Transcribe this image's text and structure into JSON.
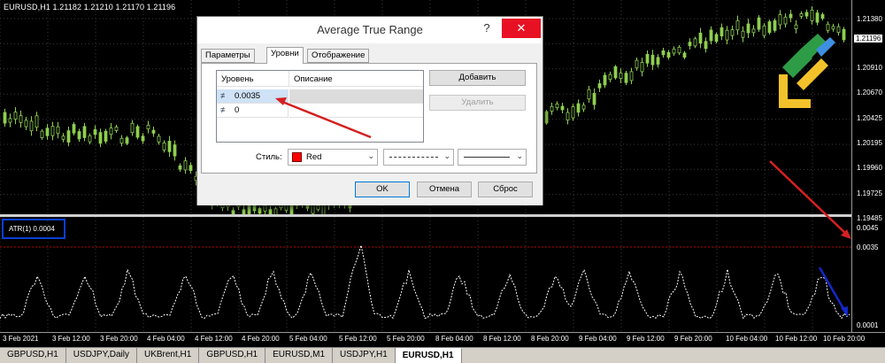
{
  "chart": {
    "header": "EURUSD,H1  1.21182 1.21210 1.21170 1.21196",
    "price_labels": [
      "1.21380",
      "1.20910",
      "1.20670",
      "1.20425",
      "1.20195",
      "1.19960",
      "1.19725",
      "1.19485"
    ],
    "current_price": "1.21196",
    "indicator_price_labels": [
      "0.0045",
      "0.0035",
      "0.0001"
    ],
    "time_labels": [
      "3 Feb 2021",
      "3 Feb 12:00",
      "3 Feb 20:00",
      "4 Feb 04:00",
      "4 Feb 12:00",
      "4 Feb 20:00",
      "5 Feb 04:00",
      "5 Feb 12:00",
      "5 Feb 20:00",
      "8 Feb 04:00",
      "8 Feb 12:00",
      "8 Feb 20:00",
      "9 Feb 04:00",
      "9 Feb 12:00",
      "9 Feb 20:00",
      "10 Feb 04:00",
      "10 Feb 12:00",
      "10 Feb 20:00"
    ],
    "atr_label": "ATR(1) 0.0004",
    "colors": {
      "up_candle": "#8fcf4f",
      "grid": "#3a3a3a",
      "level_line": "#c00000",
      "highlight_box": "#0a3fd8",
      "arrow": "#d42020"
    }
  },
  "tabs": [
    "GBPUSD,H1",
    "USDJPY,Daily",
    "UKBrent,H1",
    "GBPUSD,H1",
    "EURUSD,M1",
    "USDJPY,H1",
    "EURUSD,H1"
  ],
  "active_tab_index": 6,
  "dialog": {
    "title": "Average True Range",
    "help": "?",
    "close": "✕",
    "tabs": [
      "Параметры",
      "Уровни",
      "Отображение"
    ],
    "active_tab": "Уровни",
    "table": {
      "col_level": "Уровень",
      "col_desc": "Описание",
      "rows": [
        {
          "value": "0.0035",
          "description": "",
          "selected": true
        },
        {
          "value": "0",
          "description": "",
          "selected": false
        }
      ]
    },
    "add_button": "Добавить",
    "delete_button": "Удалить",
    "style_label": "Стиль:",
    "color_value": "Red",
    "ok": "OK",
    "cancel": "Отмена",
    "reset": "Сброс"
  }
}
